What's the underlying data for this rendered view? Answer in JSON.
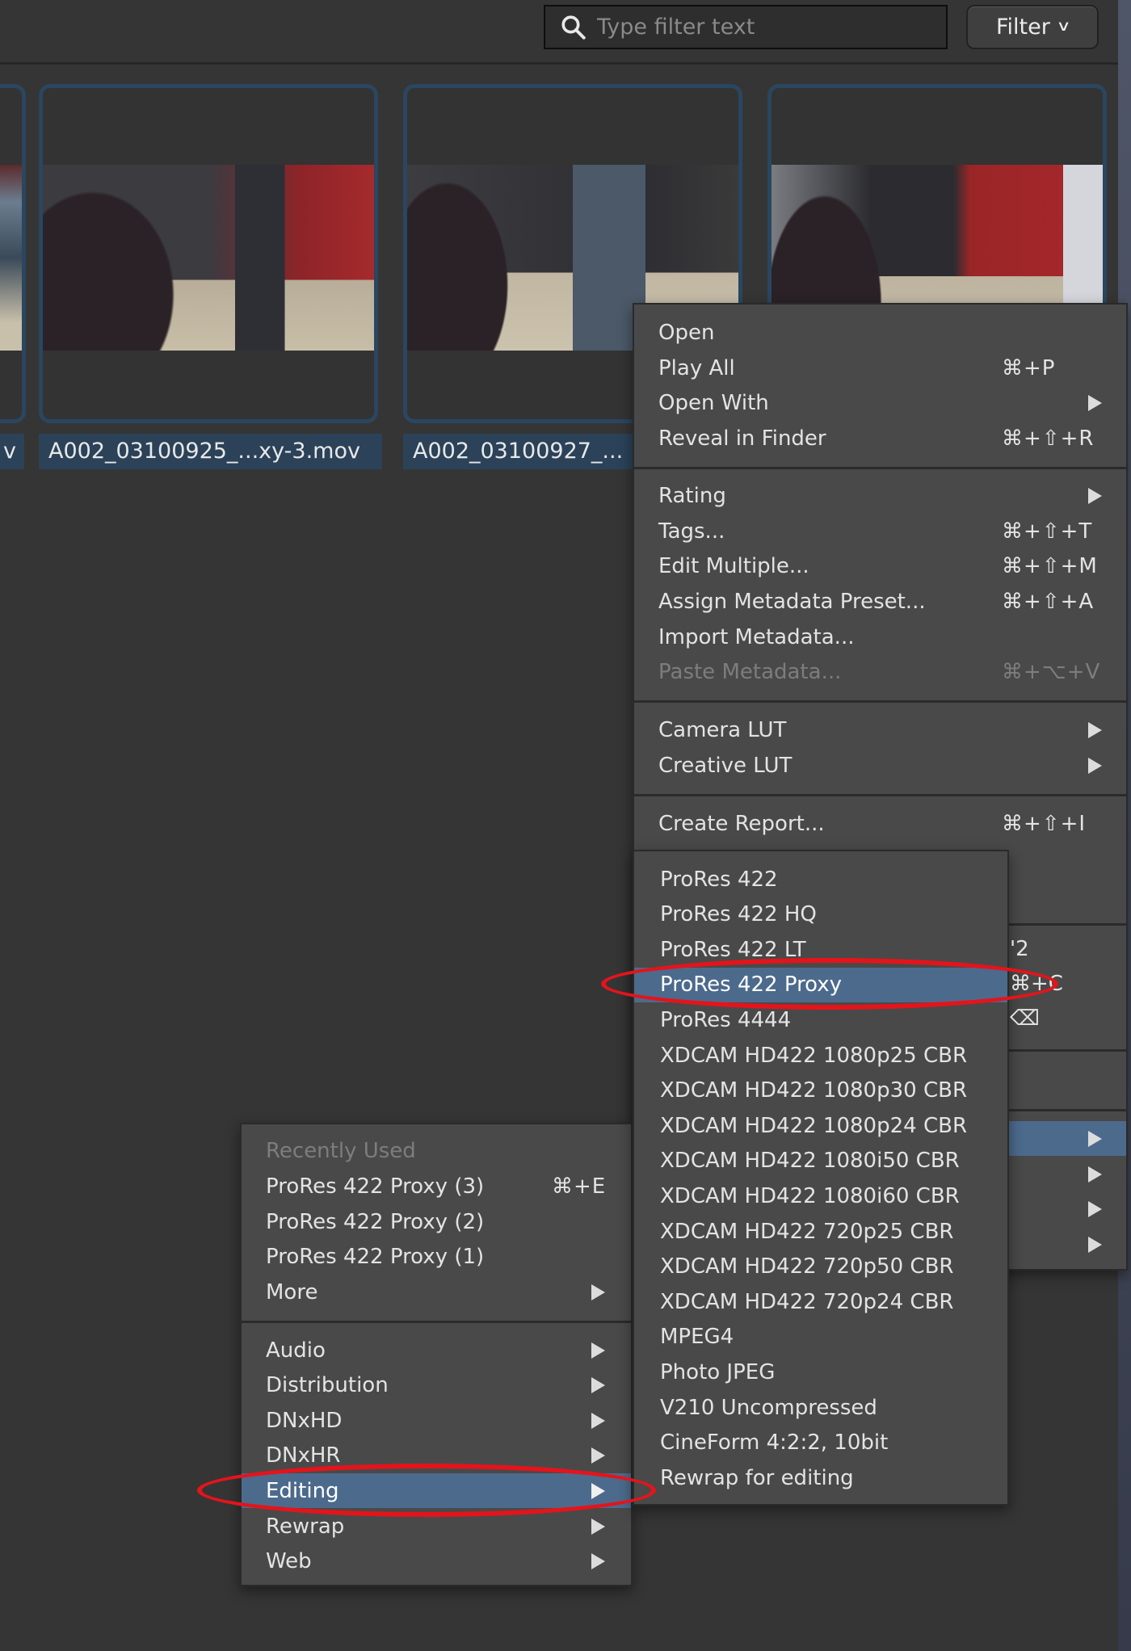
{
  "toolbar": {
    "search_placeholder": "Type filter text",
    "search_value": "",
    "search_icon": "search-icon",
    "filter_label": "Filter",
    "filter_chevron": "⌄"
  },
  "thumbnails": [
    {
      "label": "v"
    },
    {
      "label": "A002_03100925_...xy-3.mov"
    },
    {
      "label": "A002_03100927_..."
    },
    {
      "label": ""
    }
  ],
  "main_menu": {
    "items": [
      {
        "label": "Open",
        "shortcut": ""
      },
      {
        "label": "Play All",
        "shortcut": "⌘+P"
      },
      {
        "label": "Open With",
        "shortcut": "",
        "submenu": true
      },
      {
        "label": "Reveal in Finder",
        "shortcut": "⌘+⇧+R"
      },
      {
        "label": "Rating",
        "shortcut": "",
        "submenu": true
      },
      {
        "label": "Tags...",
        "shortcut": "⌘+⇧+T"
      },
      {
        "label": "Edit Multiple...",
        "shortcut": "⌘+⇧+M"
      },
      {
        "label": "Assign Metadata Preset...",
        "shortcut": "⌘+⇧+A"
      },
      {
        "label": "Import Metadata...",
        "shortcut": ""
      },
      {
        "label": "Paste Metadata...",
        "shortcut": "⌘+⌥+V",
        "disabled": true
      },
      {
        "label": "Camera LUT",
        "shortcut": "",
        "submenu": true
      },
      {
        "label": "Creative LUT",
        "shortcut": "",
        "submenu": true
      },
      {
        "label": "Create Report...",
        "shortcut": "⌘+⇧+I"
      }
    ],
    "partial_shortcuts": [
      "'2",
      "⌘+C",
      "⌫"
    ]
  },
  "editing_submenu": {
    "items": [
      {
        "label": "ProRes 422"
      },
      {
        "label": "ProRes 422 HQ"
      },
      {
        "label": "ProRes 422 LT"
      },
      {
        "label": "ProRes 422 Proxy",
        "highlighted": true
      },
      {
        "label": "ProRes 4444"
      },
      {
        "label": "XDCAM HD422 1080p25 CBR"
      },
      {
        "label": "XDCAM HD422 1080p30 CBR"
      },
      {
        "label": "XDCAM HD422 1080p24 CBR"
      },
      {
        "label": "XDCAM HD422 1080i50 CBR"
      },
      {
        "label": "XDCAM HD422 1080i60 CBR"
      },
      {
        "label": "XDCAM HD422 720p25 CBR"
      },
      {
        "label": "XDCAM HD422 720p50 CBR"
      },
      {
        "label": "XDCAM HD422 720p24 CBR"
      },
      {
        "label": "MPEG4"
      },
      {
        "label": "Photo JPEG"
      },
      {
        "label": "V210 Uncompressed"
      },
      {
        "label": "CineForm 4:2:2, 10bit"
      },
      {
        "label": "Rewrap for editing"
      }
    ]
  },
  "transcode_menu": {
    "header": "Recently Used",
    "recent": [
      {
        "label": "ProRes 422 Proxy (3)",
        "shortcut": "⌘+E"
      },
      {
        "label": "ProRes 422 Proxy (2)",
        "shortcut": ""
      },
      {
        "label": "ProRes 422 Proxy (1)",
        "shortcut": ""
      },
      {
        "label": "More",
        "submenu": true
      }
    ],
    "categories": [
      {
        "label": "Audio"
      },
      {
        "label": "Distribution"
      },
      {
        "label": "DNxHD"
      },
      {
        "label": "DNxHR"
      },
      {
        "label": "Editing",
        "highlighted": true
      },
      {
        "label": "Rewrap"
      },
      {
        "label": "Web"
      }
    ]
  },
  "colors": {
    "highlight": "#4c6a8c",
    "annotation": "#e4141b",
    "menu_bg": "#494949",
    "background": "#353535"
  }
}
